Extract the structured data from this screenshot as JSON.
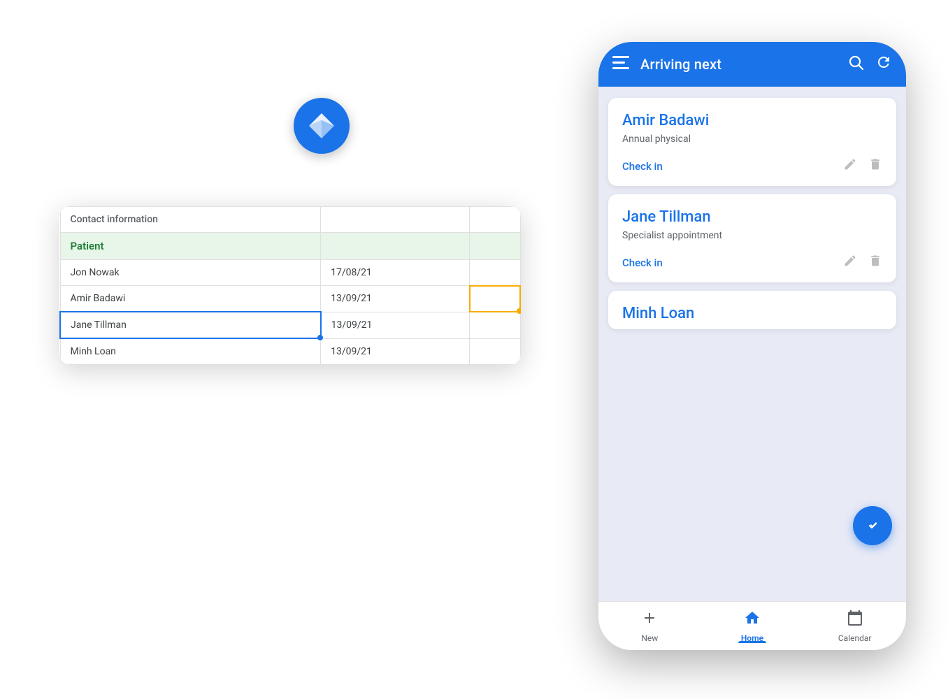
{
  "logo": {
    "alt": "App logo paper plane"
  },
  "spreadsheet": {
    "header": {
      "col1": "Contact information",
      "col2": "",
      "col3": ""
    },
    "section_label": "Patient",
    "rows": [
      {
        "name": "Jon Nowak",
        "date": "17/08/21",
        "col3": ""
      },
      {
        "name": "Amir Badawi",
        "date": "13/09/21",
        "col3": ""
      },
      {
        "name": "Jane Tillman",
        "date": "13/09/21",
        "col3": ""
      },
      {
        "name": "Minh Loan",
        "date": "13/09/21",
        "col3": ""
      }
    ]
  },
  "phone": {
    "appbar": {
      "menu_icon": "≡",
      "title": "Arriving next",
      "search_icon": "search",
      "refresh_icon": "refresh"
    },
    "cards": [
      {
        "name": "Amir Badawi",
        "appointment_type": "Annual physical",
        "check_in_label": "Check in"
      },
      {
        "name": "Jane Tillman",
        "appointment_type": "Specialist appointment",
        "check_in_label": "Check in"
      },
      {
        "name": "Minh Loan",
        "appointment_type": ""
      }
    ],
    "bottom_nav": [
      {
        "label": "New",
        "icon": "plus",
        "active": false
      },
      {
        "label": "Home",
        "icon": "home",
        "active": true
      },
      {
        "label": "Calendar",
        "icon": "calendar",
        "active": false
      }
    ]
  }
}
